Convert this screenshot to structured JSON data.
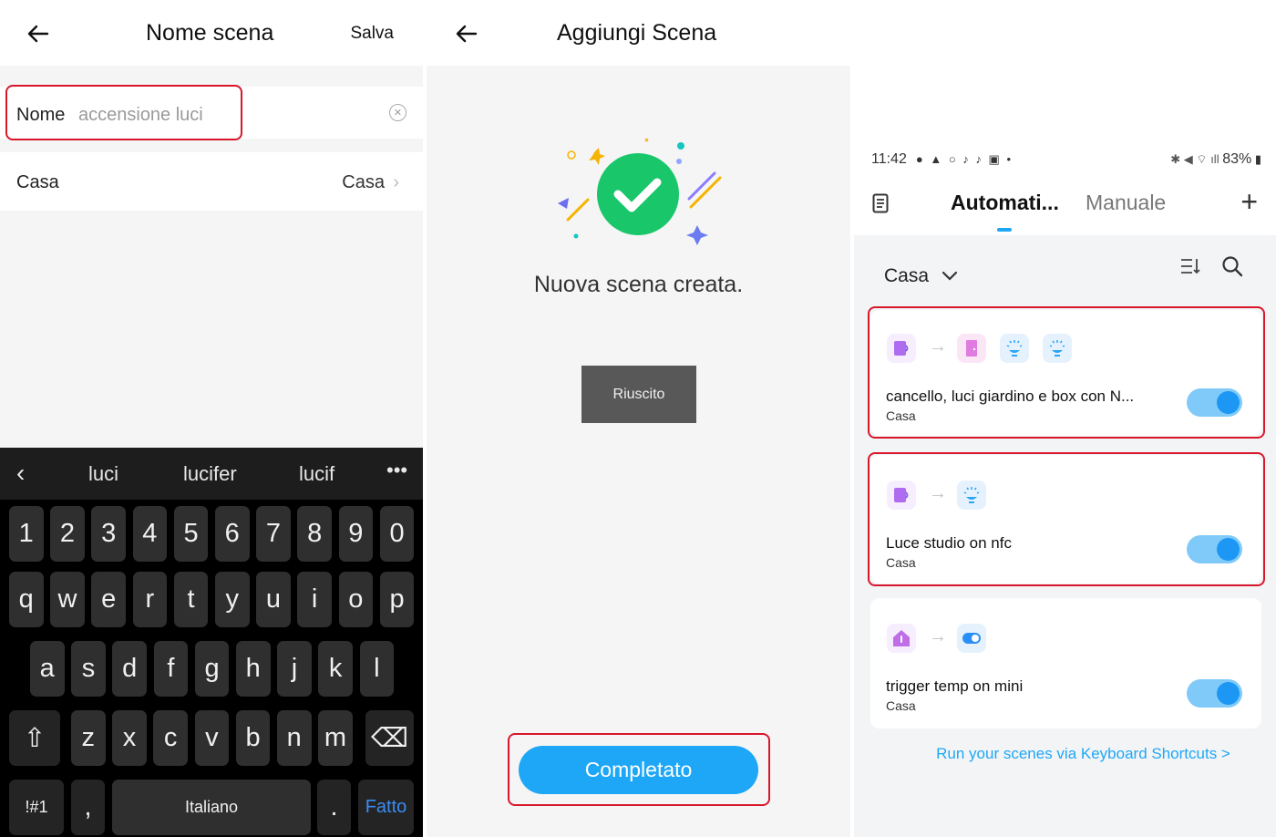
{
  "panel1": {
    "title": "Nome scena",
    "save_label": "Salva",
    "name_label": "Nome",
    "name_value": "accensione luci",
    "home_label": "Casa",
    "home_value": "Casa",
    "suggestions": [
      "luci",
      "lucifer",
      "lucif"
    ],
    "keyboard": {
      "numbers": [
        "1",
        "2",
        "3",
        "4",
        "5",
        "6",
        "7",
        "8",
        "9",
        "0"
      ],
      "row1": [
        "q",
        "w",
        "e",
        "r",
        "t",
        "y",
        "u",
        "i",
        "o",
        "p"
      ],
      "row2": [
        "a",
        "s",
        "d",
        "f",
        "g",
        "h",
        "j",
        "k",
        "l"
      ],
      "row3": [
        "z",
        "x",
        "c",
        "v",
        "b",
        "n",
        "m"
      ],
      "symbols_key": "!#1",
      "comma_key": ",",
      "space_label": "Italiano",
      "period_key": ".",
      "done_key": "Fatto"
    }
  },
  "panel2": {
    "title": "Aggiungi Scena",
    "success_text": "Nuova scena creata.",
    "toast": "Riuscito",
    "done_button": "Completato"
  },
  "panel3": {
    "time": "11:42",
    "battery": "83%",
    "tab_active": "Automati...",
    "tab_inactive": "Manuale",
    "home_selector": "Casa",
    "cards": [
      {
        "title": "cancello, luci giardino e box con N...",
        "subtitle": "Casa",
        "enabled": true
      },
      {
        "title": "Luce studio on nfc",
        "subtitle": "Casa",
        "enabled": true
      },
      {
        "title": "trigger temp on mini",
        "subtitle": "Casa",
        "enabled": true
      }
    ],
    "shortcuts_link": "Run your scenes via Keyboard Shortcuts >"
  },
  "colors": {
    "accent": "#1ea7f7",
    "highlight": "#d8172b",
    "success": "#19c76a"
  }
}
